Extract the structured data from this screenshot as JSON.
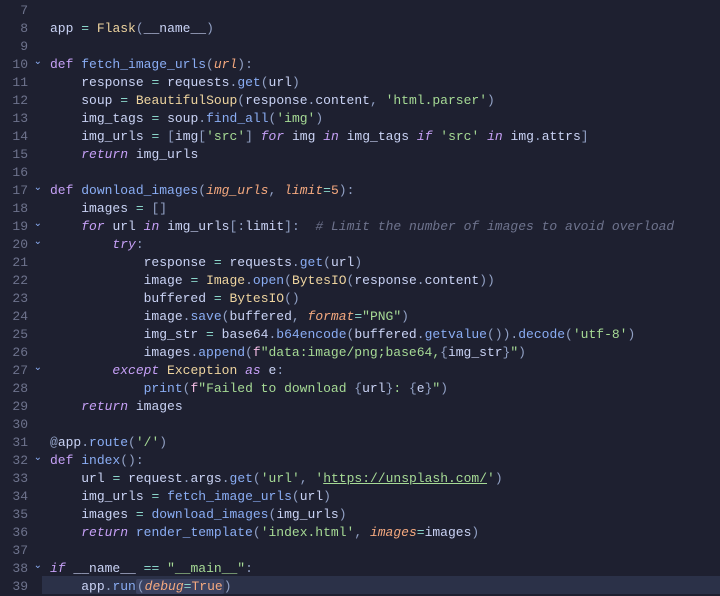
{
  "line_start": 7,
  "line_end": 39,
  "highlighted_line": 39,
  "fold_lines": [
    10,
    17,
    19,
    20,
    27,
    32,
    38
  ],
  "lines": [
    {
      "n": 7,
      "t": []
    },
    {
      "n": 8,
      "t": [
        [
          "",
          ""
        ],
        [
          "id",
          "app"
        ],
        [
          "id",
          " "
        ],
        [
          "op",
          "="
        ],
        [
          "id",
          " "
        ],
        [
          "cl",
          "Flask"
        ],
        [
          "p",
          "("
        ],
        [
          "id",
          "__name__"
        ],
        [
          "p",
          ")"
        ]
      ]
    },
    {
      "n": 9,
      "t": []
    },
    {
      "n": 10,
      "t": [
        [
          "",
          ""
        ],
        [
          "k",
          "def"
        ],
        [
          "id",
          " "
        ],
        [
          "fn",
          "fetch_image_urls"
        ],
        [
          "p",
          "("
        ],
        [
          "pa",
          "url"
        ],
        [
          "p",
          ")"
        ],
        [
          "p",
          ":"
        ]
      ]
    },
    {
      "n": 11,
      "t": [
        [
          "",
          "    "
        ],
        [
          "id",
          "response"
        ],
        [
          "id",
          " "
        ],
        [
          "op",
          "="
        ],
        [
          "id",
          " "
        ],
        [
          "id",
          "requests"
        ],
        [
          "p",
          "."
        ],
        [
          "bf",
          "get"
        ],
        [
          "p",
          "("
        ],
        [
          "id",
          "url"
        ],
        [
          "p",
          ")"
        ]
      ]
    },
    {
      "n": 12,
      "t": [
        [
          "",
          "    "
        ],
        [
          "id",
          "soup"
        ],
        [
          "id",
          " "
        ],
        [
          "op",
          "="
        ],
        [
          "id",
          " "
        ],
        [
          "cl",
          "BeautifulSoup"
        ],
        [
          "p",
          "("
        ],
        [
          "id",
          "response"
        ],
        [
          "p",
          "."
        ],
        [
          "pr",
          "content"
        ],
        [
          "p",
          ","
        ],
        [
          "id",
          " "
        ],
        [
          "s",
          "'html.parser'"
        ],
        [
          "p",
          ")"
        ]
      ]
    },
    {
      "n": 13,
      "t": [
        [
          "",
          "    "
        ],
        [
          "id",
          "img_tags"
        ],
        [
          "id",
          " "
        ],
        [
          "op",
          "="
        ],
        [
          "id",
          " "
        ],
        [
          "id",
          "soup"
        ],
        [
          "p",
          "."
        ],
        [
          "bf",
          "find_all"
        ],
        [
          "p",
          "("
        ],
        [
          "s",
          "'img'"
        ],
        [
          "p",
          ")"
        ]
      ]
    },
    {
      "n": 14,
      "t": [
        [
          "",
          "    "
        ],
        [
          "id",
          "img_urls"
        ],
        [
          "id",
          " "
        ],
        [
          "op",
          "="
        ],
        [
          "id",
          " "
        ],
        [
          "p",
          "["
        ],
        [
          "id",
          "img"
        ],
        [
          "p",
          "["
        ],
        [
          "s",
          "'src'"
        ],
        [
          "p",
          "]"
        ],
        [
          "id",
          " "
        ],
        [
          "ki",
          "for"
        ],
        [
          "id",
          " "
        ],
        [
          "id",
          "img"
        ],
        [
          "id",
          " "
        ],
        [
          "ki",
          "in"
        ],
        [
          "id",
          " "
        ],
        [
          "id",
          "img_tags"
        ],
        [
          "id",
          " "
        ],
        [
          "ki",
          "if"
        ],
        [
          "id",
          " "
        ],
        [
          "s",
          "'src'"
        ],
        [
          "id",
          " "
        ],
        [
          "ki",
          "in"
        ],
        [
          "id",
          " "
        ],
        [
          "id",
          "img"
        ],
        [
          "p",
          "."
        ],
        [
          "pr",
          "attrs"
        ],
        [
          "p",
          "]"
        ]
      ]
    },
    {
      "n": 15,
      "t": [
        [
          "",
          "    "
        ],
        [
          "ki",
          "return"
        ],
        [
          "id",
          " "
        ],
        [
          "id",
          "img_urls"
        ]
      ]
    },
    {
      "n": 16,
      "t": []
    },
    {
      "n": 17,
      "t": [
        [
          "",
          ""
        ],
        [
          "k",
          "def"
        ],
        [
          "id",
          " "
        ],
        [
          "fn",
          "download_images"
        ],
        [
          "p",
          "("
        ],
        [
          "pa",
          "img_urls"
        ],
        [
          "p",
          ","
        ],
        [
          "id",
          " "
        ],
        [
          "pa",
          "limit"
        ],
        [
          "op",
          "="
        ],
        [
          "n",
          "5"
        ],
        [
          "p",
          ")"
        ],
        [
          "p",
          ":"
        ]
      ]
    },
    {
      "n": 18,
      "t": [
        [
          "",
          "    "
        ],
        [
          "id",
          "images"
        ],
        [
          "id",
          " "
        ],
        [
          "op",
          "="
        ],
        [
          "id",
          " "
        ],
        [
          "p",
          "["
        ],
        [
          "p",
          "]"
        ]
      ]
    },
    {
      "n": 19,
      "t": [
        [
          "",
          "    "
        ],
        [
          "ki",
          "for"
        ],
        [
          "id",
          " "
        ],
        [
          "id",
          "url"
        ],
        [
          "id",
          " "
        ],
        [
          "ki",
          "in"
        ],
        [
          "id",
          " "
        ],
        [
          "id",
          "img_urls"
        ],
        [
          "p",
          "["
        ],
        [
          "p",
          ":"
        ],
        [
          "id",
          "limit"
        ],
        [
          "p",
          "]"
        ],
        [
          "p",
          ":"
        ],
        [
          "id",
          "  "
        ],
        [
          "cm",
          "# Limit the number of images to avoid overload"
        ]
      ]
    },
    {
      "n": 20,
      "t": [
        [
          "",
          "        "
        ],
        [
          "ki",
          "try"
        ],
        [
          "p",
          ":"
        ]
      ]
    },
    {
      "n": 21,
      "t": [
        [
          "",
          "            "
        ],
        [
          "id",
          "response"
        ],
        [
          "id",
          " "
        ],
        [
          "op",
          "="
        ],
        [
          "id",
          " "
        ],
        [
          "id",
          "requests"
        ],
        [
          "p",
          "."
        ],
        [
          "bf",
          "get"
        ],
        [
          "p",
          "("
        ],
        [
          "id",
          "url"
        ],
        [
          "p",
          ")"
        ]
      ]
    },
    {
      "n": 22,
      "t": [
        [
          "",
          "            "
        ],
        [
          "id",
          "image"
        ],
        [
          "id",
          " "
        ],
        [
          "op",
          "="
        ],
        [
          "id",
          " "
        ],
        [
          "cl",
          "Image"
        ],
        [
          "p",
          "."
        ],
        [
          "bf",
          "open"
        ],
        [
          "p",
          "("
        ],
        [
          "cl",
          "BytesIO"
        ],
        [
          "p",
          "("
        ],
        [
          "id",
          "response"
        ],
        [
          "p",
          "."
        ],
        [
          "pr",
          "content"
        ],
        [
          "p",
          ")"
        ],
        [
          "p",
          ")"
        ]
      ]
    },
    {
      "n": 23,
      "t": [
        [
          "",
          "            "
        ],
        [
          "id",
          "buffered"
        ],
        [
          "id",
          " "
        ],
        [
          "op",
          "="
        ],
        [
          "id",
          " "
        ],
        [
          "cl",
          "BytesIO"
        ],
        [
          "p",
          "("
        ],
        [
          "p",
          ")"
        ]
      ]
    },
    {
      "n": 24,
      "t": [
        [
          "",
          "            "
        ],
        [
          "id",
          "image"
        ],
        [
          "p",
          "."
        ],
        [
          "bf",
          "save"
        ],
        [
          "p",
          "("
        ],
        [
          "id",
          "buffered"
        ],
        [
          "p",
          ","
        ],
        [
          "id",
          " "
        ],
        [
          "pa",
          "format"
        ],
        [
          "op",
          "="
        ],
        [
          "s",
          "\"PNG\""
        ],
        [
          "p",
          ")"
        ]
      ]
    },
    {
      "n": 25,
      "t": [
        [
          "",
          "            "
        ],
        [
          "id",
          "img_str"
        ],
        [
          "id",
          " "
        ],
        [
          "op",
          "="
        ],
        [
          "id",
          " "
        ],
        [
          "id",
          "base64"
        ],
        [
          "p",
          "."
        ],
        [
          "bf",
          "b64encode"
        ],
        [
          "p",
          "("
        ],
        [
          "id",
          "buffered"
        ],
        [
          "p",
          "."
        ],
        [
          "bf",
          "getvalue"
        ],
        [
          "p",
          "("
        ],
        [
          "p",
          ")"
        ],
        [
          "p",
          ")"
        ],
        [
          "p",
          "."
        ],
        [
          "bf",
          "decode"
        ],
        [
          "p",
          "("
        ],
        [
          "s",
          "'utf-8'"
        ],
        [
          "p",
          ")"
        ]
      ]
    },
    {
      "n": 26,
      "t": [
        [
          "",
          "            "
        ],
        [
          "id",
          "images"
        ],
        [
          "p",
          "."
        ],
        [
          "bf",
          "append"
        ],
        [
          "p",
          "("
        ],
        [
          "mg",
          "f"
        ],
        [
          "s",
          "\"data:image/png;base64,"
        ],
        [
          "p",
          "{"
        ],
        [
          "id",
          "img_str"
        ],
        [
          "p",
          "}"
        ],
        [
          "s",
          "\""
        ],
        [
          "p",
          ")"
        ]
      ]
    },
    {
      "n": 27,
      "t": [
        [
          "",
          "        "
        ],
        [
          "ki",
          "except"
        ],
        [
          "id",
          " "
        ],
        [
          "cl",
          "Exception"
        ],
        [
          "id",
          " "
        ],
        [
          "ki",
          "as"
        ],
        [
          "id",
          " "
        ],
        [
          "id",
          "e"
        ],
        [
          "p",
          ":"
        ]
      ]
    },
    {
      "n": 28,
      "t": [
        [
          "",
          "            "
        ],
        [
          "bf",
          "print"
        ],
        [
          "p",
          "("
        ],
        [
          "mg",
          "f"
        ],
        [
          "s",
          "\"Failed to download "
        ],
        [
          "p",
          "{"
        ],
        [
          "id",
          "url"
        ],
        [
          "p",
          "}"
        ],
        [
          "s",
          ": "
        ],
        [
          "p",
          "{"
        ],
        [
          "id",
          "e"
        ],
        [
          "p",
          "}"
        ],
        [
          "s",
          "\""
        ],
        [
          "p",
          ")"
        ]
      ]
    },
    {
      "n": 29,
      "t": [
        [
          "",
          "    "
        ],
        [
          "ki",
          "return"
        ],
        [
          "id",
          " "
        ],
        [
          "id",
          "images"
        ]
      ]
    },
    {
      "n": 30,
      "t": []
    },
    {
      "n": 31,
      "t": [
        [
          "",
          ""
        ],
        [
          "p",
          "@"
        ],
        [
          "id",
          "app"
        ],
        [
          "p",
          "."
        ],
        [
          "bf",
          "route"
        ],
        [
          "p",
          "("
        ],
        [
          "s",
          "'/'"
        ],
        [
          "p",
          ")"
        ]
      ]
    },
    {
      "n": 32,
      "t": [
        [
          "",
          ""
        ],
        [
          "k",
          "def"
        ],
        [
          "id",
          " "
        ],
        [
          "fn",
          "index"
        ],
        [
          "p",
          "("
        ],
        [
          "p",
          ")"
        ],
        [
          "p",
          ":"
        ]
      ]
    },
    {
      "n": 33,
      "t": [
        [
          "",
          "    "
        ],
        [
          "id",
          "url"
        ],
        [
          "id",
          " "
        ],
        [
          "op",
          "="
        ],
        [
          "id",
          " "
        ],
        [
          "id",
          "request"
        ],
        [
          "p",
          "."
        ],
        [
          "pr",
          "args"
        ],
        [
          "p",
          "."
        ],
        [
          "bf",
          "get"
        ],
        [
          "p",
          "("
        ],
        [
          "s",
          "'url'"
        ],
        [
          "p",
          ","
        ],
        [
          "id",
          " "
        ],
        [
          "s",
          "'"
        ],
        [
          "su",
          "https://unsplash.com/"
        ],
        [
          "s",
          "'"
        ],
        [
          "p",
          ")"
        ]
      ]
    },
    {
      "n": 34,
      "t": [
        [
          "",
          "    "
        ],
        [
          "id",
          "img_urls"
        ],
        [
          "id",
          " "
        ],
        [
          "op",
          "="
        ],
        [
          "id",
          " "
        ],
        [
          "bf",
          "fetch_image_urls"
        ],
        [
          "p",
          "("
        ],
        [
          "id",
          "url"
        ],
        [
          "p",
          ")"
        ]
      ]
    },
    {
      "n": 35,
      "t": [
        [
          "",
          "    "
        ],
        [
          "id",
          "images"
        ],
        [
          "id",
          " "
        ],
        [
          "op",
          "="
        ],
        [
          "id",
          " "
        ],
        [
          "bf",
          "download_images"
        ],
        [
          "p",
          "("
        ],
        [
          "id",
          "img_urls"
        ],
        [
          "p",
          ")"
        ]
      ]
    },
    {
      "n": 36,
      "t": [
        [
          "",
          "    "
        ],
        [
          "ki",
          "return"
        ],
        [
          "id",
          " "
        ],
        [
          "bf",
          "render_template"
        ],
        [
          "p",
          "("
        ],
        [
          "s",
          "'index.html'"
        ],
        [
          "p",
          ","
        ],
        [
          "id",
          " "
        ],
        [
          "pa",
          "images"
        ],
        [
          "op",
          "="
        ],
        [
          "id",
          "images"
        ],
        [
          "p",
          ")"
        ]
      ]
    },
    {
      "n": 37,
      "t": []
    },
    {
      "n": 38,
      "t": [
        [
          "",
          ""
        ],
        [
          "ki",
          "if"
        ],
        [
          "id",
          " "
        ],
        [
          "id",
          "__name__"
        ],
        [
          "id",
          " "
        ],
        [
          "op",
          "=="
        ],
        [
          "id",
          " "
        ],
        [
          "s",
          "\"__main__\""
        ],
        [
          "p",
          ":"
        ]
      ]
    },
    {
      "n": 39,
      "t": [
        [
          "",
          "    "
        ],
        [
          "id",
          "app"
        ],
        [
          "p",
          "."
        ],
        [
          "bf",
          "run"
        ],
        [
          "selopen",
          ""
        ],
        [
          "p",
          "("
        ],
        [
          "pa",
          "debug"
        ],
        [
          "op",
          "="
        ],
        [
          "co",
          "True"
        ],
        [
          "selclose",
          ""
        ],
        [
          "p",
          ")"
        ]
      ]
    }
  ],
  "token_class_map": {
    "k": "c-k",
    "ki": "c-ki",
    "fn": "c-fn",
    "bf": "c-bf",
    "id": "c-id",
    "pr": "c-pr",
    "p": "c-p",
    "op": "c-op",
    "s": "c-s",
    "su": "c-su",
    "n": "c-n",
    "cm": "c-cm",
    "cl": "c-cl",
    "pa": "c-pa",
    "co": "c-co",
    "se": "c-se",
    "mg": "c-mg"
  },
  "fold_glyph": "⌄"
}
